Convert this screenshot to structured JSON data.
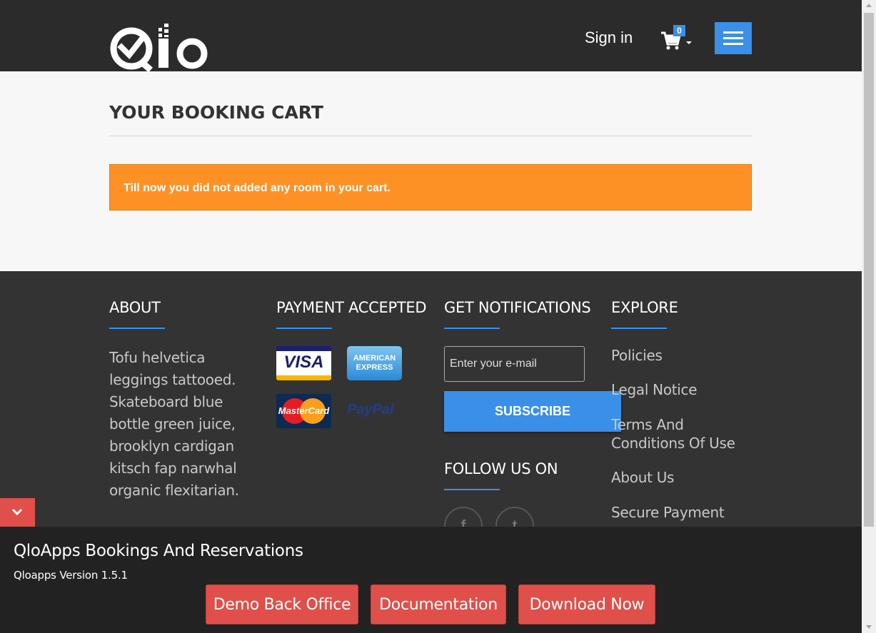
{
  "header": {
    "logo_text": "Qlo",
    "signin_label": "Sign in",
    "cart_count": "0"
  },
  "main": {
    "title": "YOUR BOOKING CART",
    "alert": "Till now you did not added any room in your cart."
  },
  "footer": {
    "about": {
      "title": "ABOUT",
      "text": "Tofu helvetica leggings tattooed. Skateboard blue bottle green juice, brooklyn cardigan kitsch fap narwhal organic flexitarian."
    },
    "payment": {
      "title": "PAYMENT ACCEPTED",
      "cards": {
        "visa": "VISA",
        "amex": "AMERICAN EXPRESS",
        "mastercard": "MasterCard",
        "paypal": "PayPal"
      }
    },
    "notifications": {
      "title": "GET NOTIFICATIONS",
      "email_placeholder": "Enter your e-mail",
      "subscribe_label": "SUBSCRIBE",
      "follow_title": "FOLLOW US ON",
      "social": [
        "f",
        "t"
      ]
    },
    "explore": {
      "title": "EXPLORE",
      "links": [
        "Policies",
        "Legal Notice",
        "Terms And Conditions Of Use",
        "About Us",
        "Secure Payment"
      ]
    }
  },
  "banner": {
    "title": "QloApps Bookings And Reservations",
    "version": "Qloapps Version 1.5.1",
    "buttons": [
      "Demo Back Office",
      "Documentation",
      "Download Now"
    ]
  },
  "colors": {
    "accent": "#3a8fe8",
    "alert": "#fe9126",
    "banner_button": "#e04f4a",
    "header_bg": "#2b2b2b",
    "footer_bg": "#333333"
  }
}
